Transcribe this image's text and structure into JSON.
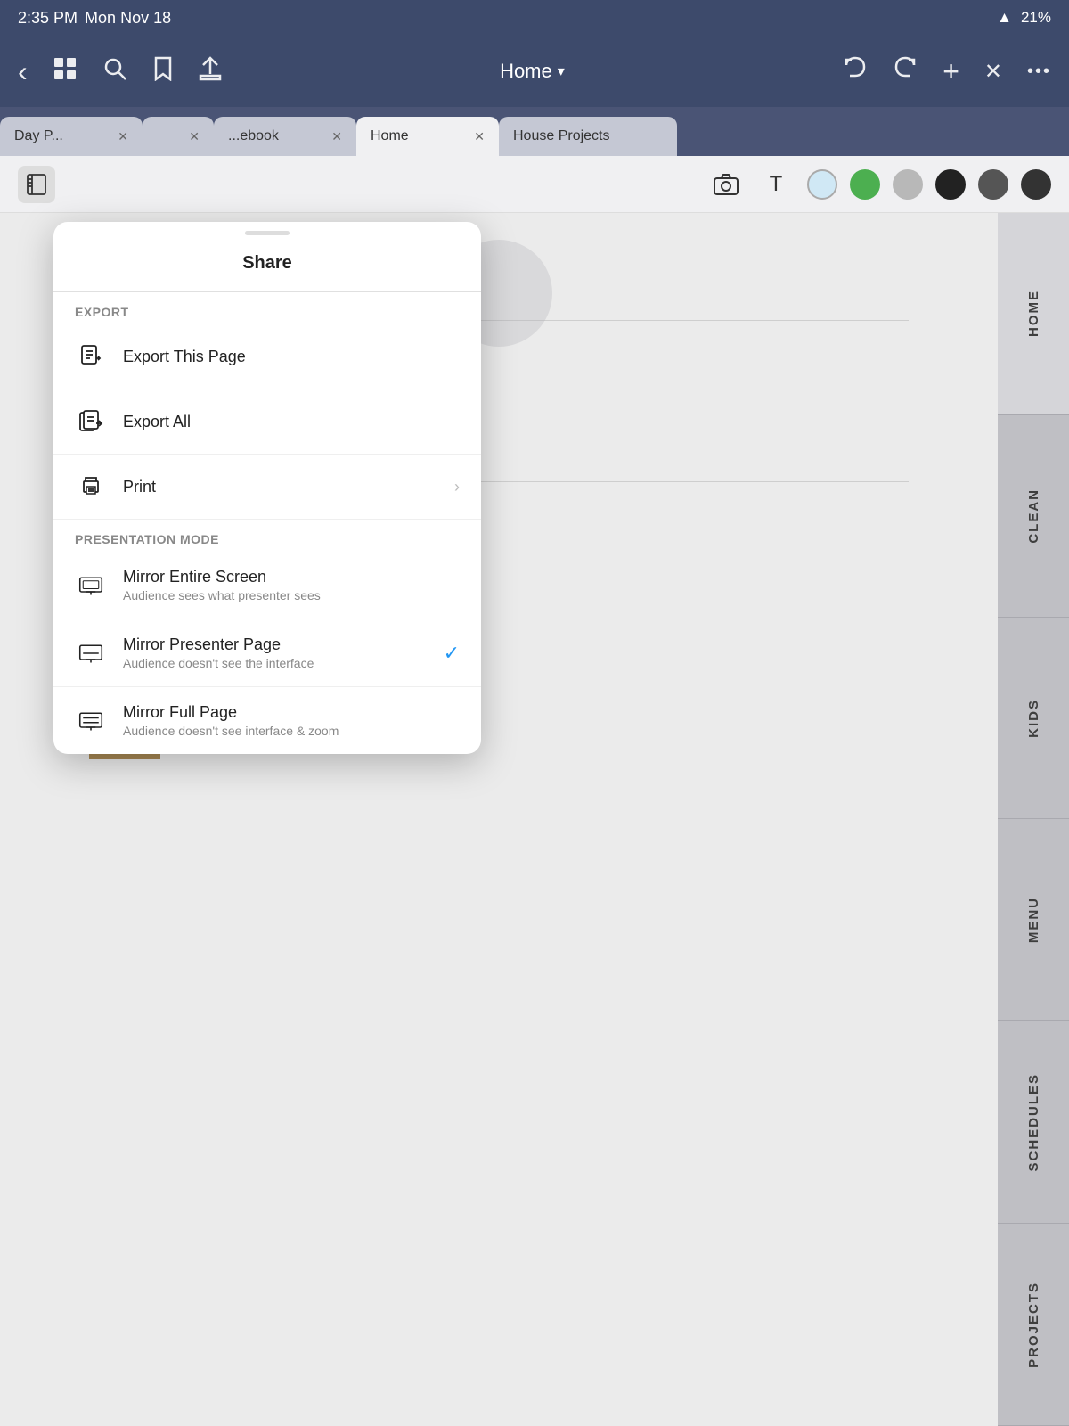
{
  "statusBar": {
    "time": "2:35 PM",
    "date": "Mon Nov 18",
    "wifi": "📶",
    "battery": "21%"
  },
  "toolbar": {
    "backIcon": "‹",
    "gridIcon": "⊞",
    "searchIcon": "⌕",
    "bookmarkIcon": "🔖",
    "shareIcon": "⬆",
    "title": "Home",
    "chevron": "▾",
    "undoIcon": "↩",
    "redoIcon": "↪",
    "addIcon": "+",
    "closeIcon": "✕",
    "moreIcon": "•••"
  },
  "tabs": [
    {
      "label": "Day P...",
      "active": false
    },
    {
      "label": "",
      "active": false
    },
    {
      "label": "...ebook",
      "active": false
    },
    {
      "label": "Home",
      "active": true
    },
    {
      "label": "House Projects",
      "active": false
    }
  ],
  "drawingTools": {
    "notebookIcon": "📓",
    "cameraIcon": "📷",
    "textIcon": "T"
  },
  "colors": [
    {
      "hex": "#d0e8f5",
      "name": "light-blue"
    },
    {
      "hex": "#4caf50",
      "name": "green"
    },
    {
      "hex": "#b0b0b0",
      "name": "gray"
    },
    {
      "hex": "#222222",
      "name": "black"
    },
    {
      "hex": "#555555",
      "name": "dark-gray"
    },
    {
      "hex": "#333333",
      "name": "charcoal"
    }
  ],
  "sharePopup": {
    "title": "Share",
    "dragIndicator": true,
    "exportSection": {
      "label": "EXPORT",
      "items": [
        {
          "id": "export-page",
          "title": "Export This Page",
          "subtitle": "",
          "hasChevron": false,
          "hasCheck": false,
          "iconType": "export-page"
        },
        {
          "id": "export-all",
          "title": "Export All",
          "subtitle": "",
          "hasChevron": false,
          "hasCheck": false,
          "iconType": "export-all"
        },
        {
          "id": "print",
          "title": "Print",
          "subtitle": "",
          "hasChevron": true,
          "hasCheck": false,
          "iconType": "print"
        }
      ]
    },
    "presentationSection": {
      "label": "PRESENTATION MODE",
      "items": [
        {
          "id": "mirror-screen",
          "title": "Mirror Entire Screen",
          "subtitle": "Audience sees what presenter sees",
          "hasChevron": false,
          "hasCheck": false,
          "iconType": "mirror-screen"
        },
        {
          "id": "mirror-presenter",
          "title": "Mirror Presenter Page",
          "subtitle": "Audience doesn't see the interface",
          "hasChevron": false,
          "hasCheck": true,
          "iconType": "mirror-presenter"
        },
        {
          "id": "mirror-full",
          "title": "Mirror Full Page",
          "subtitle": "Audience doesn't see interface & zoom",
          "hasChevron": false,
          "hasCheck": false,
          "iconType": "mirror-full"
        }
      ]
    }
  },
  "noteSections": [
    {
      "id": "menu",
      "colorHex": "#9a9a9a",
      "title": "Menu"
    },
    {
      "id": "schedules",
      "colorHex": "#ede8e0",
      "title": "Schedules"
    },
    {
      "id": "projects",
      "colorHex": "#b5935a",
      "title": "Projects"
    }
  ],
  "sidebar": {
    "items": [
      {
        "label": "HOME",
        "active": true
      },
      {
        "label": "CLEAN",
        "active": false
      },
      {
        "label": "KIDS",
        "active": false
      },
      {
        "label": "MENU",
        "active": false
      },
      {
        "label": "SCHEDULES",
        "active": false
      },
      {
        "label": "PROJECTS",
        "active": false
      }
    ]
  }
}
